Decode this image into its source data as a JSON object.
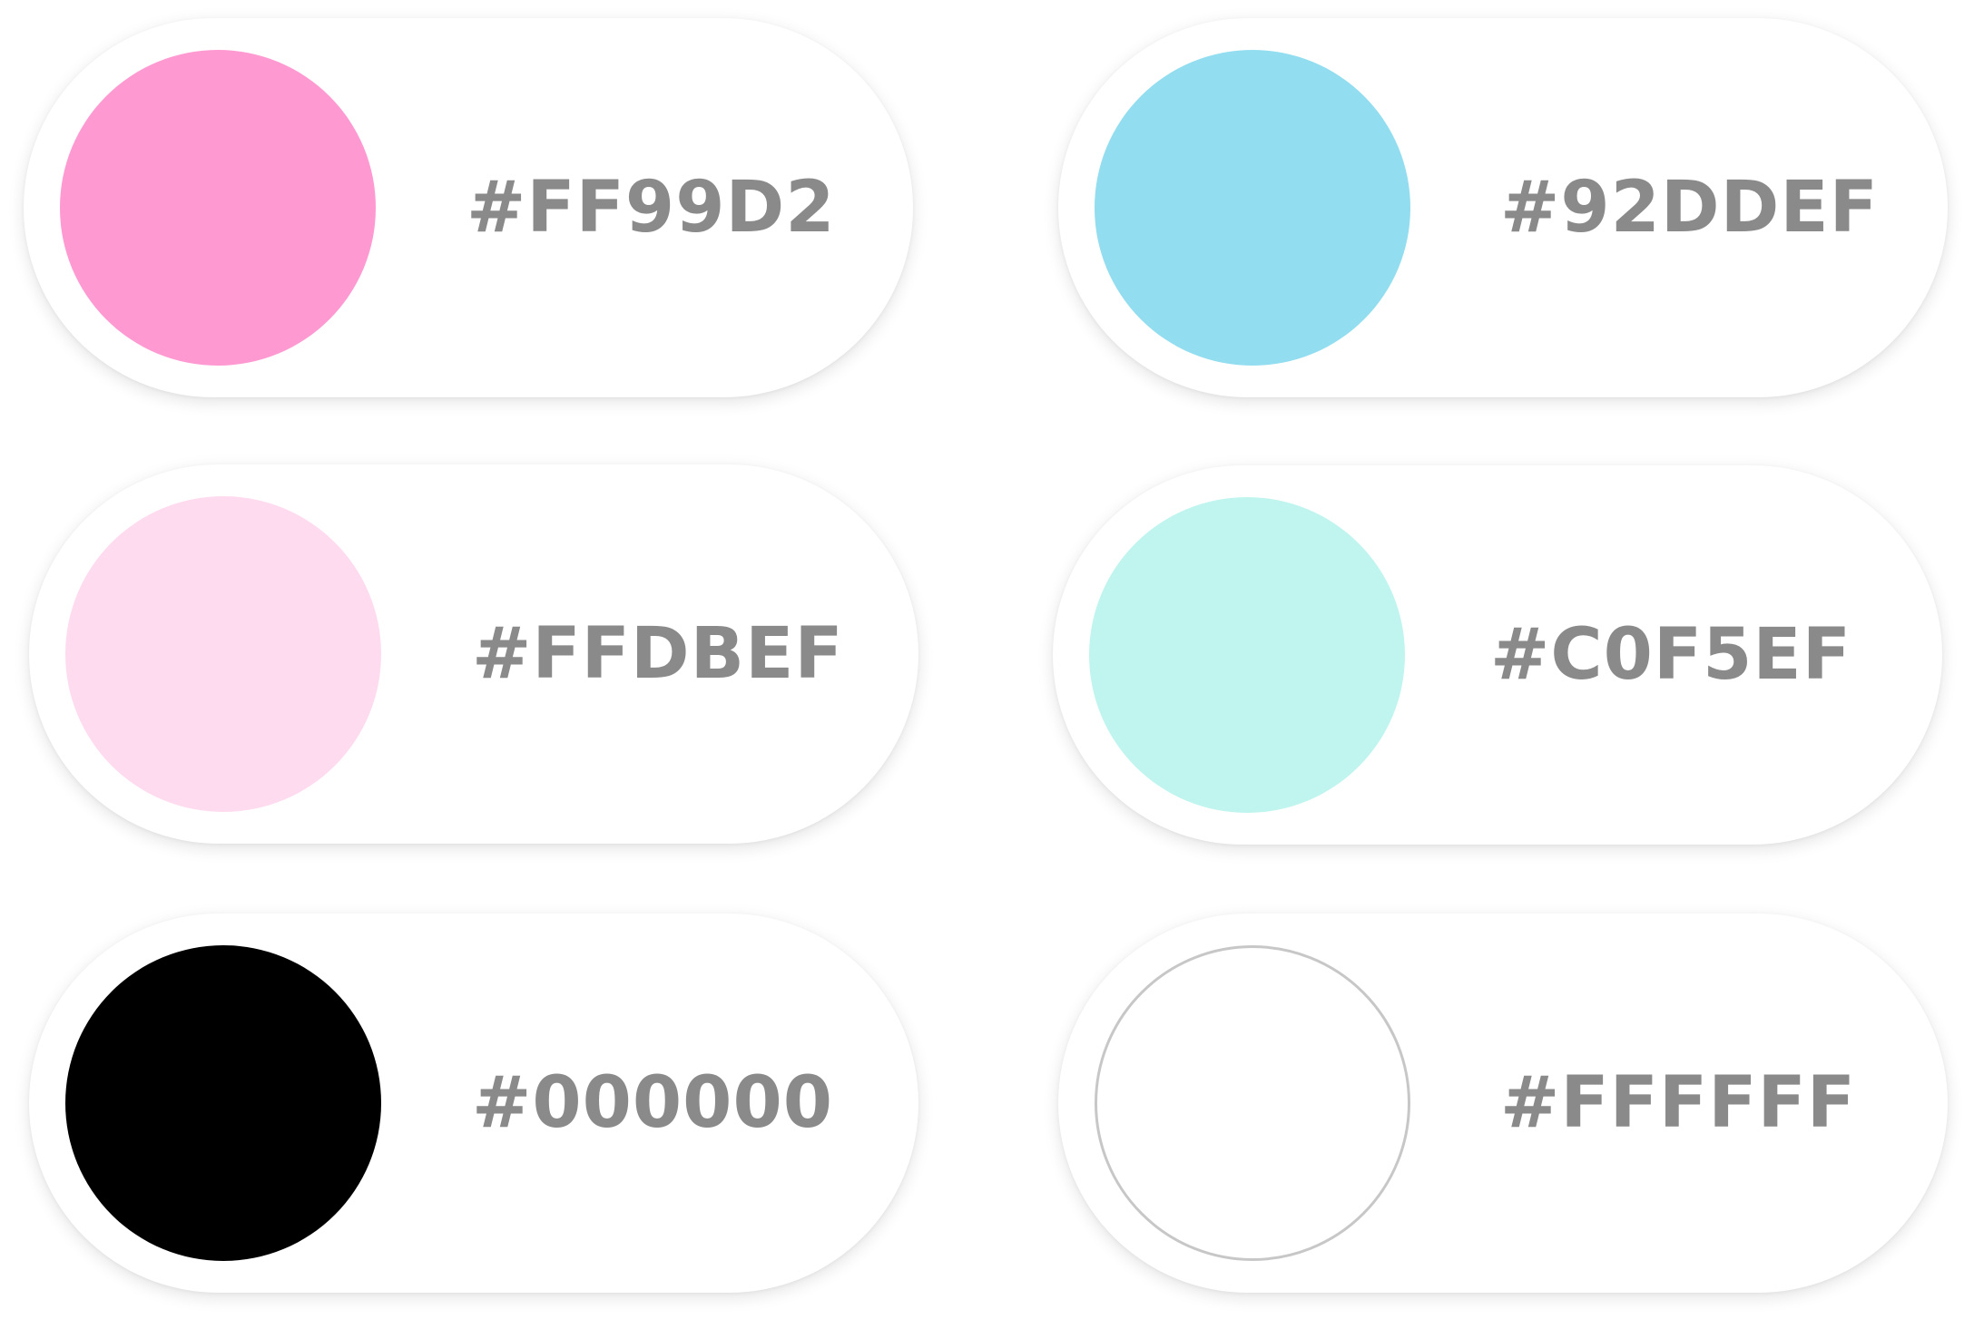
{
  "swatches": [
    {
      "hex": "#FF99D2",
      "color": "#FF99D2"
    },
    {
      "hex": "#92DDEF",
      "color": "#92DDEF"
    },
    {
      "hex": "#FFDBEF",
      "color": "#FFDBEF"
    },
    {
      "hex": "#C0F5EF",
      "color": "#C0F5EF"
    },
    {
      "hex": "#000000",
      "color": "#000000"
    },
    {
      "hex": "#FFFFFF",
      "color": "#FFFFFF"
    }
  ],
  "text_color": "#8A8A8A",
  "outline_color": "#C7C7C7"
}
